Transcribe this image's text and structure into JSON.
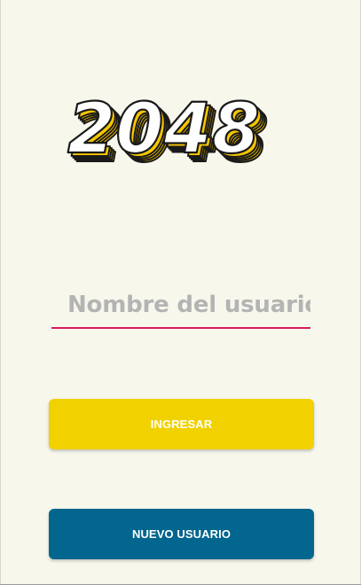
{
  "logo": {
    "text": "2048",
    "icon": "2048-logo-icon",
    "colors": {
      "face": "#ffffff",
      "side": "#f5c600",
      "outline": "#1a1a1a"
    }
  },
  "login": {
    "username_placeholder": "Nombre del usuario",
    "username_value": "",
    "underline_color": "#d81b60"
  },
  "buttons": {
    "ingresar_label": "INGRESAR",
    "ingresar_color": "#f1d100",
    "nuevo_usuario_label": "NUEVO USUARIO",
    "nuevo_usuario_color": "#02668f"
  },
  "background_color": "#f7f7ec"
}
